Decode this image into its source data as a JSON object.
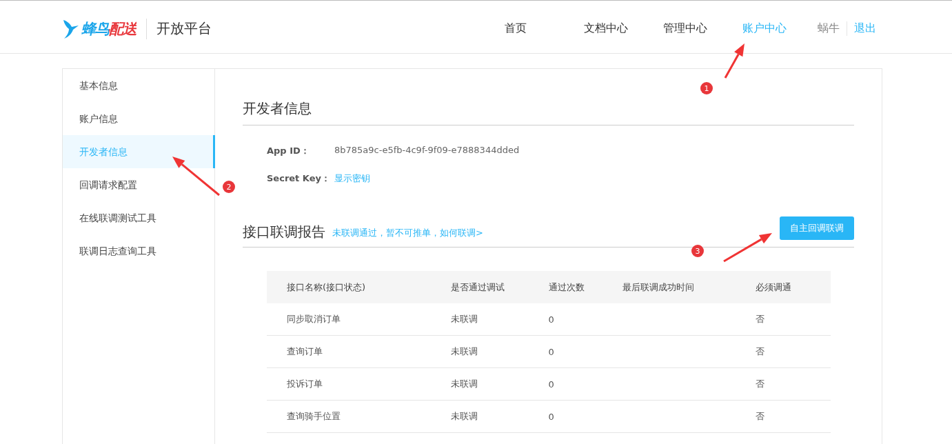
{
  "header": {
    "logo_text": "蜂鸟配送",
    "platform_title": "开放平台",
    "nav": [
      {
        "label": "首页",
        "selected": false
      },
      {
        "label": "文档中心",
        "selected": false
      },
      {
        "label": "管理中心",
        "selected": false
      },
      {
        "label": "账户中心",
        "selected": true
      }
    ],
    "user_name": "蜗牛",
    "logout": "退出"
  },
  "sidebar": {
    "items": [
      {
        "label": "基本信息",
        "selected": false
      },
      {
        "label": "账户信息",
        "selected": false
      },
      {
        "label": "开发者信息",
        "selected": true
      },
      {
        "label": "回调请求配置",
        "selected": false
      },
      {
        "label": "在线联调测试工具",
        "selected": false
      },
      {
        "label": "联调日志查询工具",
        "selected": false
      }
    ]
  },
  "developer_info": {
    "title": "开发者信息",
    "fields": [
      {
        "label": "App ID：",
        "value": "8b785a9c-e5fb-4c9f-9f09-e7888344dded",
        "kind": "text"
      },
      {
        "label": "Secret Key：",
        "value": "显示密钥",
        "kind": "link"
      }
    ]
  },
  "report": {
    "title": "接口联调报告",
    "notice_link": "未联调通过，暂不可推单，如何联调>",
    "button": "自主回调联调",
    "table": {
      "columns": [
        "接口名称(接口状态)",
        "是否通过调试",
        "通过次数",
        "最后联调成功时间",
        "必须调通"
      ],
      "rows": [
        [
          "同步取消订单",
          "未联调",
          "0",
          "",
          "否"
        ],
        [
          "查询订单",
          "未联调",
          "0",
          "",
          "否"
        ],
        [
          "投诉订单",
          "未联调",
          "0",
          "",
          "否"
        ],
        [
          "查询骑手位置",
          "未联调",
          "0",
          "",
          "否"
        ]
      ]
    }
  },
  "annotations": [
    {
      "label": "1"
    },
    {
      "label": "2"
    },
    {
      "label": "3"
    }
  ]
}
